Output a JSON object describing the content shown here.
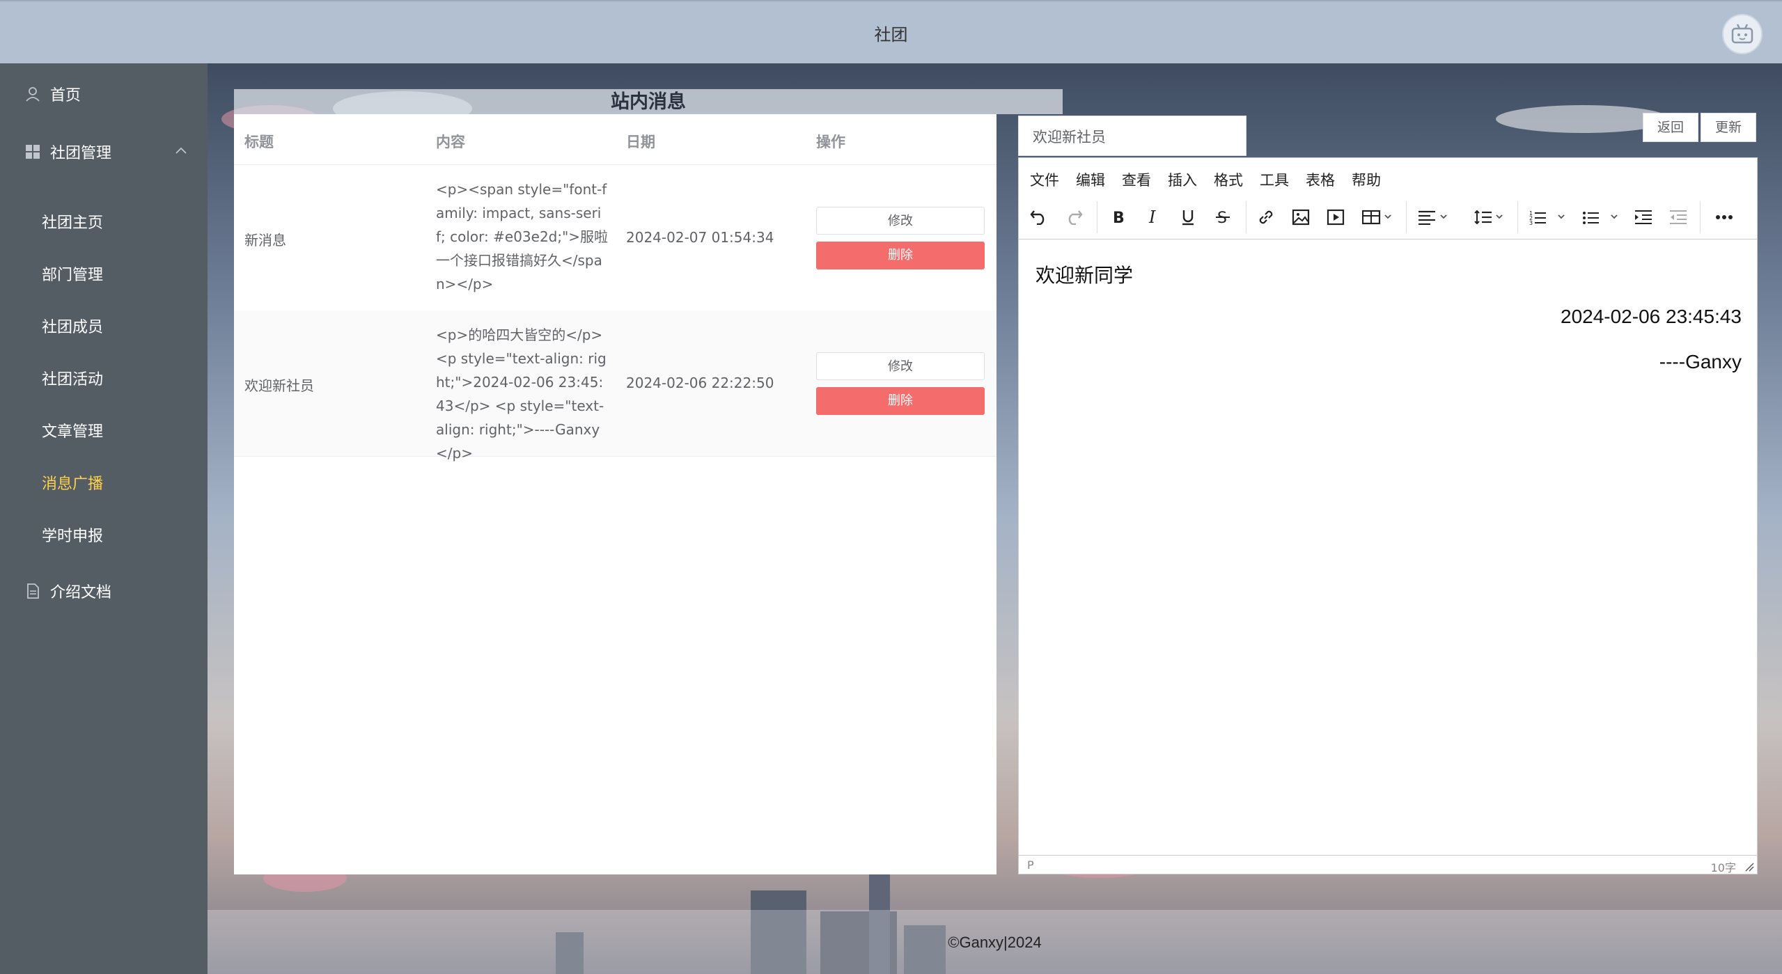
{
  "header": {
    "title": "社团"
  },
  "sidebar": {
    "items": [
      {
        "label": "首页"
      },
      {
        "label": "社团管理"
      }
    ],
    "sub_items": [
      {
        "label": "社团主页"
      },
      {
        "label": "部门管理"
      },
      {
        "label": "社团成员"
      },
      {
        "label": "社团活动"
      },
      {
        "label": "文章管理"
      },
      {
        "label": "消息广播"
      },
      {
        "label": "学时申报"
      }
    ],
    "bottom_item": {
      "label": "介绍文档"
    },
    "active_color": "#ffd04b"
  },
  "panel": {
    "title": "站内消息"
  },
  "table": {
    "headers": [
      "标题",
      "内容",
      "日期",
      "操作"
    ],
    "rows": [
      {
        "title": "新消息",
        "content": "<p><span style=\"font-family: impact, sans-serif; color: #e03e2d;\">服啦 一个接口报错搞好久</span></p>",
        "date": "2024-02-07 01:54:34",
        "edit": "修改",
        "delete": "删除"
      },
      {
        "title": "欢迎新社员",
        "content": "<p>的哈四大皆空的</p> <p style=\"text-align: right;\">2024-02-06 23:45:43</p> <p style=\"text-align: right;\">----Ganxy</p>",
        "date": "2024-02-06 22:22:50",
        "edit": "修改",
        "delete": "删除"
      }
    ]
  },
  "editor": {
    "title_value": "欢迎新社员",
    "buttons": {
      "back": "返回",
      "update": "更新"
    },
    "menus": [
      "文件",
      "编辑",
      "查看",
      "插入",
      "格式",
      "工具",
      "表格",
      "帮助"
    ],
    "body": {
      "line1": "欢迎新同学",
      "line2": "2024-02-06 23:45:43",
      "line3": "----Ganxy"
    },
    "status": {
      "path": "P",
      "word_count": "10字"
    }
  },
  "footer": {
    "text": "©Ganxy|2024"
  },
  "colors": {
    "danger": "#f56c6c",
    "sidebar_bg": "#545c64",
    "header_bg": "#b3c0d2"
  }
}
